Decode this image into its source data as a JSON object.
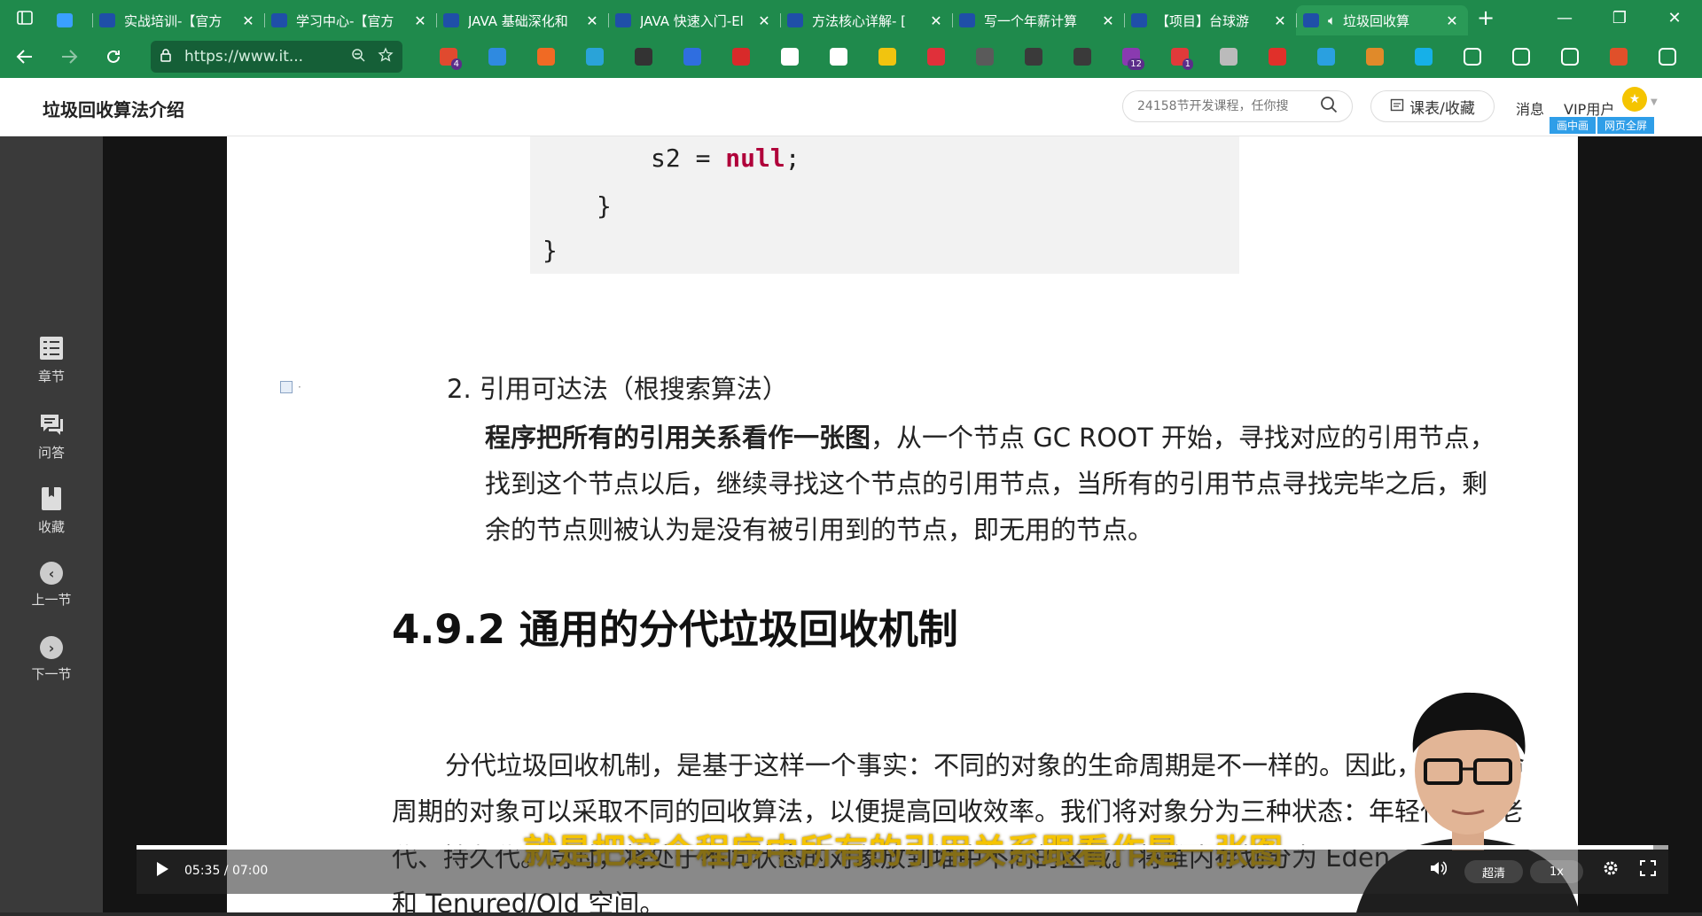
{
  "browser": {
    "tabs": [
      {
        "title": "",
        "color": "#3aa0ff"
      },
      {
        "title": "实战培训-【官方",
        "color": "#1f4fa8"
      },
      {
        "title": "学习中心-【官方",
        "color": "#1f4fa8"
      },
      {
        "title": "JAVA 基础深化和",
        "color": "#1f4fa8"
      },
      {
        "title": "JAVA 快速入门-El",
        "color": "#1f4fa8"
      },
      {
        "title": "方法核心详解- [",
        "color": "#1f4fa8"
      },
      {
        "title": "写一个年薪计算",
        "color": "#1f4fa8"
      },
      {
        "title": "【项目】台球游",
        "color": "#1f4fa8"
      },
      {
        "title": "垃圾回收算",
        "color": "#1f4fa8"
      }
    ],
    "close_glyph": "✕",
    "new_tab": "+",
    "window_controls": [
      "—",
      "❐",
      "✕"
    ],
    "address": {
      "url": "https://www.it...",
      "zoom_icon": "search-minus-icon"
    },
    "extensions": [
      {
        "name": "extension-1",
        "color": "#e04a2f",
        "badge": "4"
      },
      {
        "name": "extension-2",
        "color": "#2f8ae0",
        "badge": ""
      },
      {
        "name": "extension-3",
        "color": "#f06a24",
        "badge": ""
      },
      {
        "name": "extension-4",
        "color": "#2aa3d8",
        "badge": ""
      },
      {
        "name": "extension-5",
        "color": "#333333",
        "badge": ""
      },
      {
        "name": "extension-6",
        "color": "#2f6ee0",
        "badge": ""
      },
      {
        "name": "adblock-extension",
        "color": "#d82a2a",
        "badge": ""
      },
      {
        "name": "extension-8",
        "color": "#ffffff",
        "badge": ""
      },
      {
        "name": "extension-9",
        "color": "#ffffff",
        "badge": ""
      },
      {
        "name": "extension-10",
        "color": "#f1c40f",
        "badge": ""
      },
      {
        "name": "extension-11",
        "color": "#e0303a",
        "badge": ""
      },
      {
        "name": "extension-12",
        "color": "#5a5a5a",
        "badge": ""
      },
      {
        "name": "extension-13",
        "color": "#3a3a3a",
        "badge": ""
      },
      {
        "name": "extension-14",
        "color": "#3a3a3a",
        "badge": ""
      },
      {
        "name": "extension-15",
        "color": "#8a3ab0",
        "badge": "12"
      },
      {
        "name": "extension-16",
        "color": "#e03a3a",
        "badge": "1"
      },
      {
        "name": "extension-17",
        "color": "#bbbbbb",
        "badge": ""
      },
      {
        "name": "extension-18",
        "color": "#e0302a",
        "badge": ""
      },
      {
        "name": "extension-19",
        "color": "#2aa0e0",
        "badge": ""
      },
      {
        "name": "extension-20",
        "color": "#e08a2a",
        "badge": ""
      },
      {
        "name": "extension-21",
        "color": "#16b0e8",
        "badge": ""
      },
      {
        "name": "extensions-menu",
        "color": "#1f8a4c",
        "badge": ""
      },
      {
        "name": "favorites",
        "color": "#1f8a4c",
        "badge": ""
      },
      {
        "name": "collections",
        "color": "#1f8a4c",
        "badge": ""
      },
      {
        "name": "profile",
        "color": "#e0502a",
        "badge": ""
      },
      {
        "name": "more-menu",
        "color": "#1f8a4c",
        "badge": ""
      }
    ]
  },
  "header": {
    "title": "垃圾回收算法介绍",
    "search_placeholder": "24158节开发课程，任你搜",
    "course_button": "课表/收藏",
    "messages": "消息",
    "vip": "VIP用户",
    "pip": "画中画",
    "fullpage": "网页全屏"
  },
  "leftnav": [
    {
      "label": "章节",
      "icon": "chapters-icon"
    },
    {
      "label": "问答",
      "icon": "qa-icon"
    },
    {
      "label": "收藏",
      "icon": "bookmark-icon"
    },
    {
      "label": "上一节",
      "icon": "chevron-left-icon"
    },
    {
      "label": "下一节",
      "icon": "chevron-right-icon"
    }
  ],
  "document": {
    "code_line1_var": "s2 = ",
    "code_line1_kw": "null",
    "code_line1_end": ";",
    "code_line2": "}",
    "code_line3": "}",
    "item_heading": "2.  引用可达法（根搜索算法）",
    "item_bold": "程序把所有的引用关系看作一张图",
    "item_rest": "，从一个节点 GC ROOT 开始，寻找对应的引用节点，找到这个节点以后，继续寻找这个节点的引用节点，当所有的引用节点寻找完毕之后，剩余的节点则被认为是没有被引用到的节点，即无用的节点。",
    "section_heading": "4.9.2  通用的分代垃圾回收机制",
    "section_para": "分代垃圾回收机制，是基于这样一个事实：不同的对象的生命周期是不一样的。因此，不同生命周期的对象可以采取不同的回收算法，以便提高回收效率。我们将对象分为三种状态：年轻代、年老代、持久代。同时，将处于不同状态的对象放到堆中不同的区域。将堆内存划分为 Eden、Survivor 和 Tenured/Old 空间。"
  },
  "player": {
    "subtitle": "就是把这个程序中所有的引用关系跟看作是一张图",
    "time": "05:35 / 07:00",
    "progress_fraction": 0.99,
    "quality": "超清",
    "speed": "1x"
  }
}
